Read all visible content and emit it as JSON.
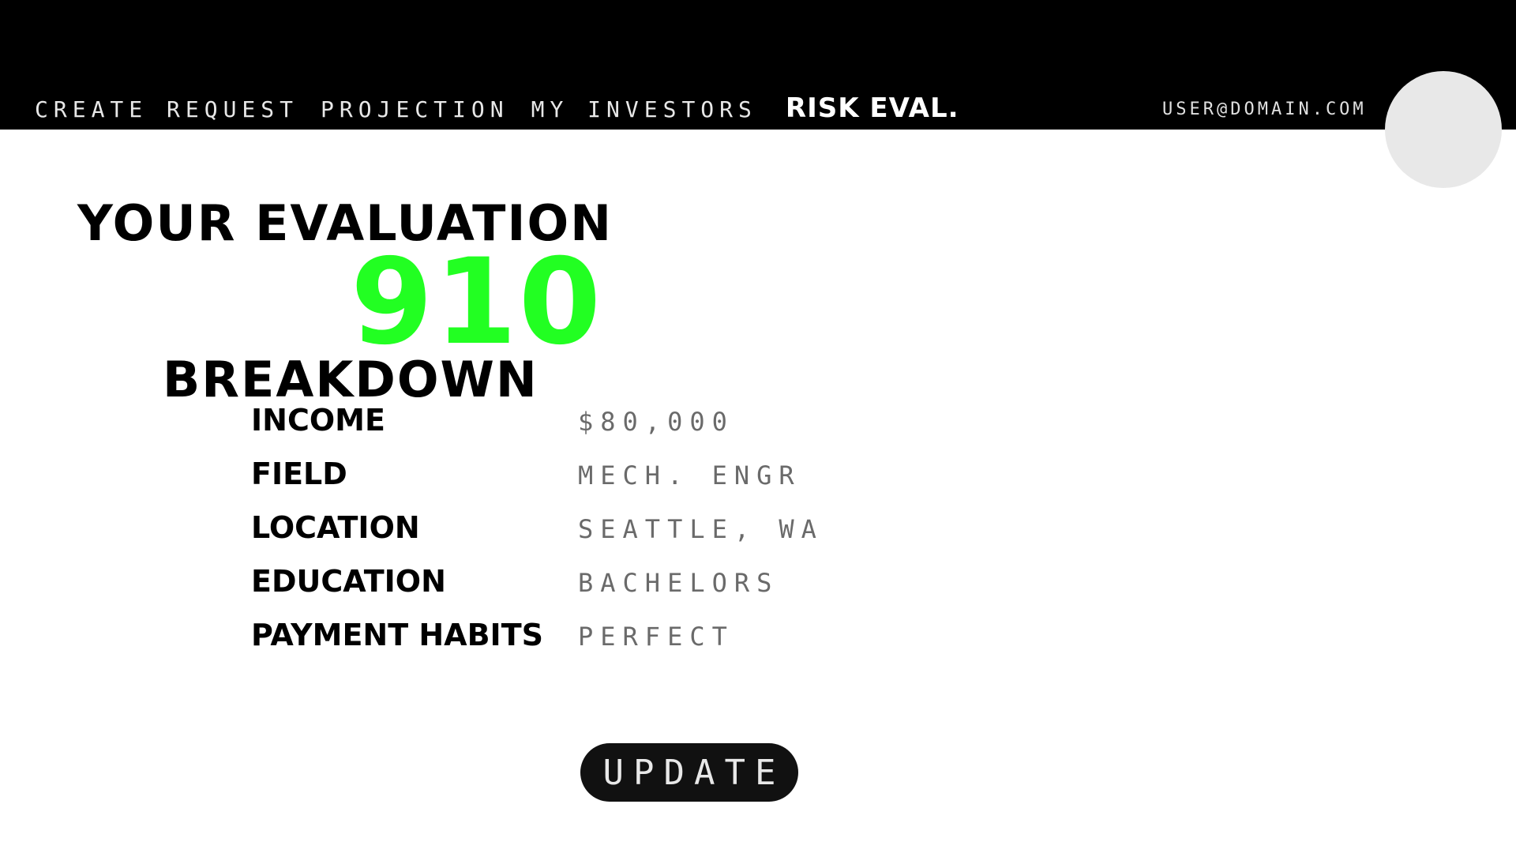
{
  "nav": {
    "items": [
      {
        "label": "CREATE REQUEST",
        "active": false
      },
      {
        "label": "PROJECTION",
        "active": false
      },
      {
        "label": "MY INVESTORS",
        "active": false
      },
      {
        "label": "RISK EVAL.",
        "active": true
      }
    ],
    "user_email": "USER@DOMAIN.COM"
  },
  "evaluation": {
    "title": "YOUR EVALUATION",
    "score": "910",
    "score_color": "#22ff22"
  },
  "breakdown": {
    "title": "BREAKDOWN",
    "rows": [
      {
        "label": "INCOME",
        "value": "$80,000"
      },
      {
        "label": "FIELD",
        "value": "MECH. ENGR"
      },
      {
        "label": "LOCATION",
        "value": "SEATTLE, WA"
      },
      {
        "label": "EDUCATION",
        "value": "BACHELORS"
      },
      {
        "label": "PAYMENT HABITS",
        "value": "PERFECT"
      }
    ]
  },
  "actions": {
    "update_label": "UPDATE"
  },
  "colors": {
    "header_bg": "#000000",
    "page_bg": "#ffffff",
    "accent": "#22ff22",
    "avatar": "#e8e8e8",
    "button_bg": "#111111"
  }
}
